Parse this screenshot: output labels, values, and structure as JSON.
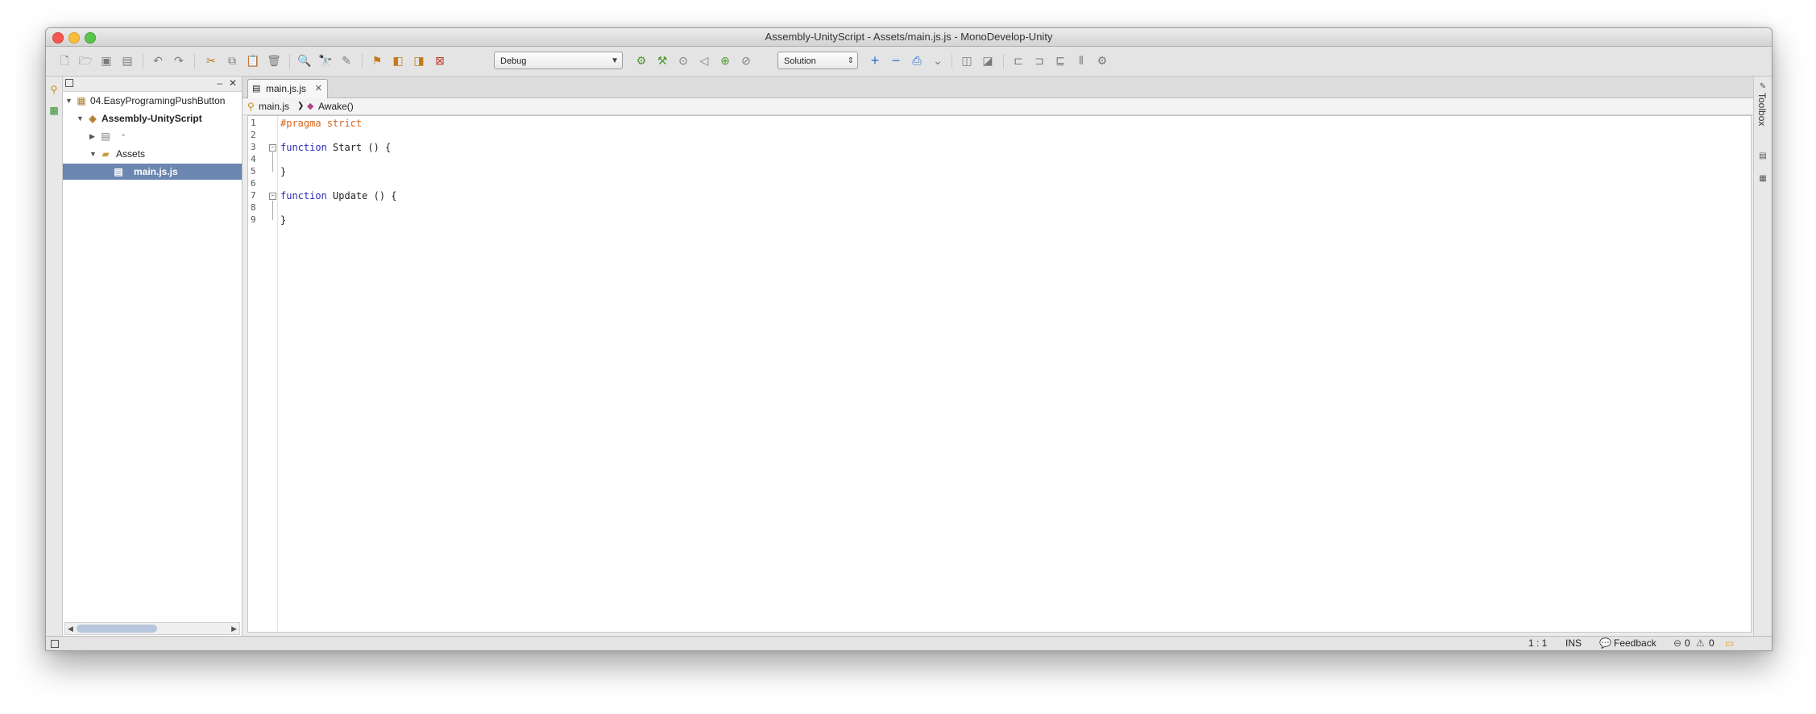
{
  "window": {
    "title": "Assembly-UnityScript - Assets/main.js.js - MonoDevelop-Unity"
  },
  "toolbar": {
    "config_value": "Debug",
    "scope_value": "Solution"
  },
  "solution_pad": {
    "tree": [
      {
        "label": "04.EasyProgramingPushButton"
      },
      {
        "label": "Assembly-UnityScript"
      },
      {
        "label": ""
      },
      {
        "label": "Assets"
      },
      {
        "label": "main.js.js"
      }
    ]
  },
  "editor": {
    "tab_label": "main.js.js",
    "breadcrumb_file": "main.js",
    "breadcrumb_member": "Awake()",
    "lines": [
      {
        "num": "1",
        "text": "#pragma strict"
      },
      {
        "num": "2",
        "text": ""
      },
      {
        "num": "3",
        "kw": "function",
        "rest": " Start () {"
      },
      {
        "num": "4",
        "text": ""
      },
      {
        "num": "5",
        "text": "}"
      },
      {
        "num": "6",
        "text": ""
      },
      {
        "num": "7",
        "kw": "function",
        "rest": " Update () {"
      },
      {
        "num": "8",
        "text": ""
      },
      {
        "num": "9",
        "text": "}"
      }
    ]
  },
  "right_pad": {
    "toolbox_label": "Toolbox"
  },
  "status": {
    "position": "1 : 1",
    "mode": "INS",
    "feedback_label": "Feedback",
    "errors": "0",
    "warnings": "0"
  }
}
